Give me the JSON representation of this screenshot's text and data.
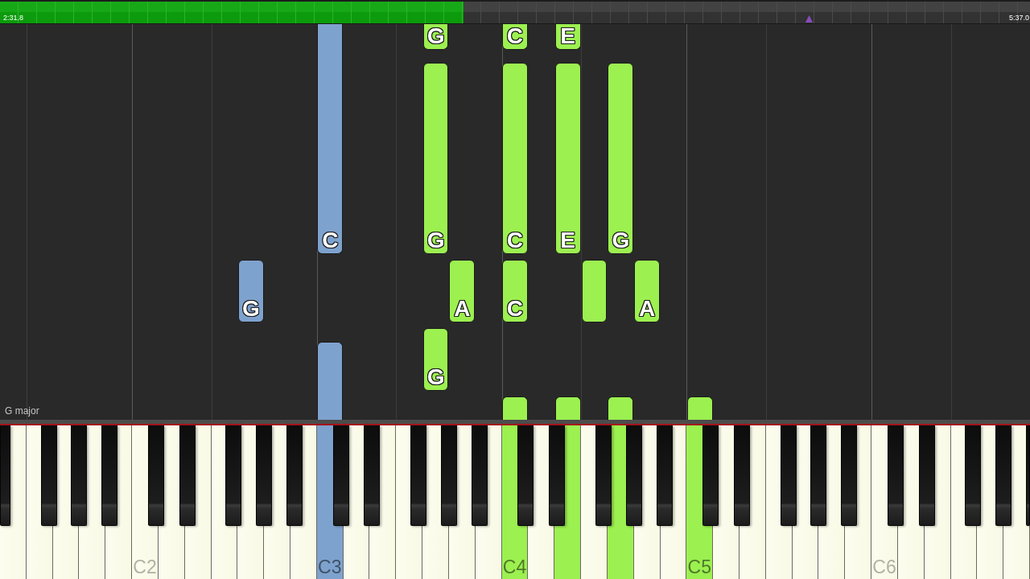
{
  "progress": {
    "elapsed": "2:31.8",
    "total": "5:37.0",
    "level": 0.45
  },
  "roll": {
    "key_signature": "G major"
  },
  "notes": [
    {
      "letter": "G",
      "color": "#9cf050"
    },
    {
      "letter": "C",
      "color": "#9cf050"
    },
    {
      "letter": "E",
      "color": "#9cf050"
    },
    {
      "letter": "C",
      "color": "#7ea2ce"
    },
    {
      "letter": "G",
      "color": "#9cf050"
    },
    {
      "letter": "C",
      "color": "#9cf050"
    },
    {
      "letter": "E",
      "color": "#9cf050"
    },
    {
      "letter": "G",
      "color": "#9cf050"
    },
    {
      "letter": "G",
      "color": "#7ea2ce"
    },
    {
      "letter": "A",
      "color": "#9cf050"
    },
    {
      "letter": "C",
      "color": "#9cf050"
    },
    {
      "color": "#9cf050"
    },
    {
      "letter": "A",
      "color": "#9cf050"
    },
    {
      "letter": "G",
      "color": "#9cf050"
    },
    {
      "color": "#7ea2ce"
    },
    {
      "color": "#9cf050"
    },
    {
      "color": "#9cf050"
    },
    {
      "color": "#9cf050"
    },
    {
      "color": "#9cf050"
    }
  ],
  "keyboard": {
    "white_keys": [
      {
        "pressed": false
      },
      {
        "pressed": false
      },
      {
        "pressed": false
      },
      {
        "pressed": false
      },
      {
        "pressed": false
      },
      {
        "label": "C2",
        "pressed": false
      },
      {
        "pressed": false
      },
      {
        "pressed": false
      },
      {
        "pressed": false
      },
      {
        "pressed": false
      },
      {
        "pressed": false
      },
      {
        "pressed": false
      },
      {
        "label": "C3",
        "pressed": true,
        "color": "#7ea2ce"
      },
      {
        "pressed": false
      },
      {
        "pressed": false
      },
      {
        "pressed": false
      },
      {
        "pressed": false
      },
      {
        "pressed": false
      },
      {
        "pressed": false
      },
      {
        "label": "C4",
        "pressed": true,
        "color": "#9cf050"
      },
      {
        "pressed": false
      },
      {
        "pressed": true,
        "color": "#9cf050"
      },
      {
        "pressed": false
      },
      {
        "pressed": true,
        "color": "#9cf050"
      },
      {
        "pressed": false
      },
      {
        "pressed": false
      },
      {
        "label": "C5",
        "pressed": true,
        "color": "#9cf050"
      },
      {
        "pressed": false
      },
      {
        "pressed": false
      },
      {
        "pressed": false
      },
      {
        "pressed": false
      },
      {
        "pressed": false
      },
      {
        "pressed": false
      },
      {
        "label": "C6",
        "pressed": false
      },
      {
        "pressed": false
      },
      {
        "pressed": false
      },
      {
        "pressed": false
      },
      {
        "pressed": false
      },
      {
        "pressed": false
      }
    ]
  }
}
